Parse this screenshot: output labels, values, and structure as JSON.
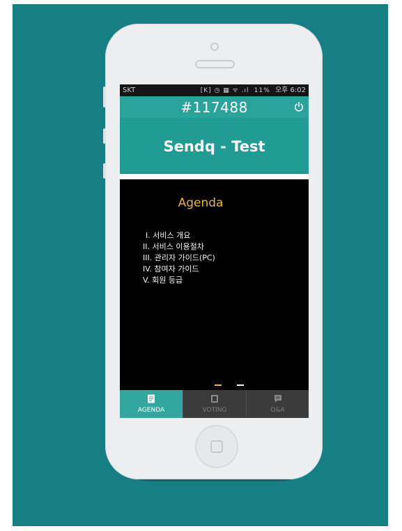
{
  "status_bar": {
    "carrier": "SKT",
    "indicators": "[K] ◷ ▦ ᯤ .ıl",
    "battery": "11%",
    "clock": "오후 6:02"
  },
  "app": {
    "session_code": "#117488",
    "power_icon": "power-icon",
    "event_name": "Sendq - Test"
  },
  "slide": {
    "title": "Agenda",
    "items": [
      "I. 서비스 개요",
      "II. 서비스 이용절차",
      "III. 관리자 가이드(PC)",
      "IV. 참여자 가이드",
      "V. 회원 등급"
    ],
    "current_page": 1,
    "total_pages": 2
  },
  "tabs": [
    {
      "label": "AGENDA",
      "icon": "document-icon",
      "active": true
    },
    {
      "label": "VOTING",
      "icon": "square-icon",
      "active": false
    },
    {
      "label": "Q&A",
      "icon": "chat-icon",
      "active": false
    }
  ],
  "colors": {
    "background": "#157f84",
    "app_teal": "#2aa39a",
    "accent_yellow": "#f1b624",
    "tab_bar": "#3b3b3b"
  }
}
